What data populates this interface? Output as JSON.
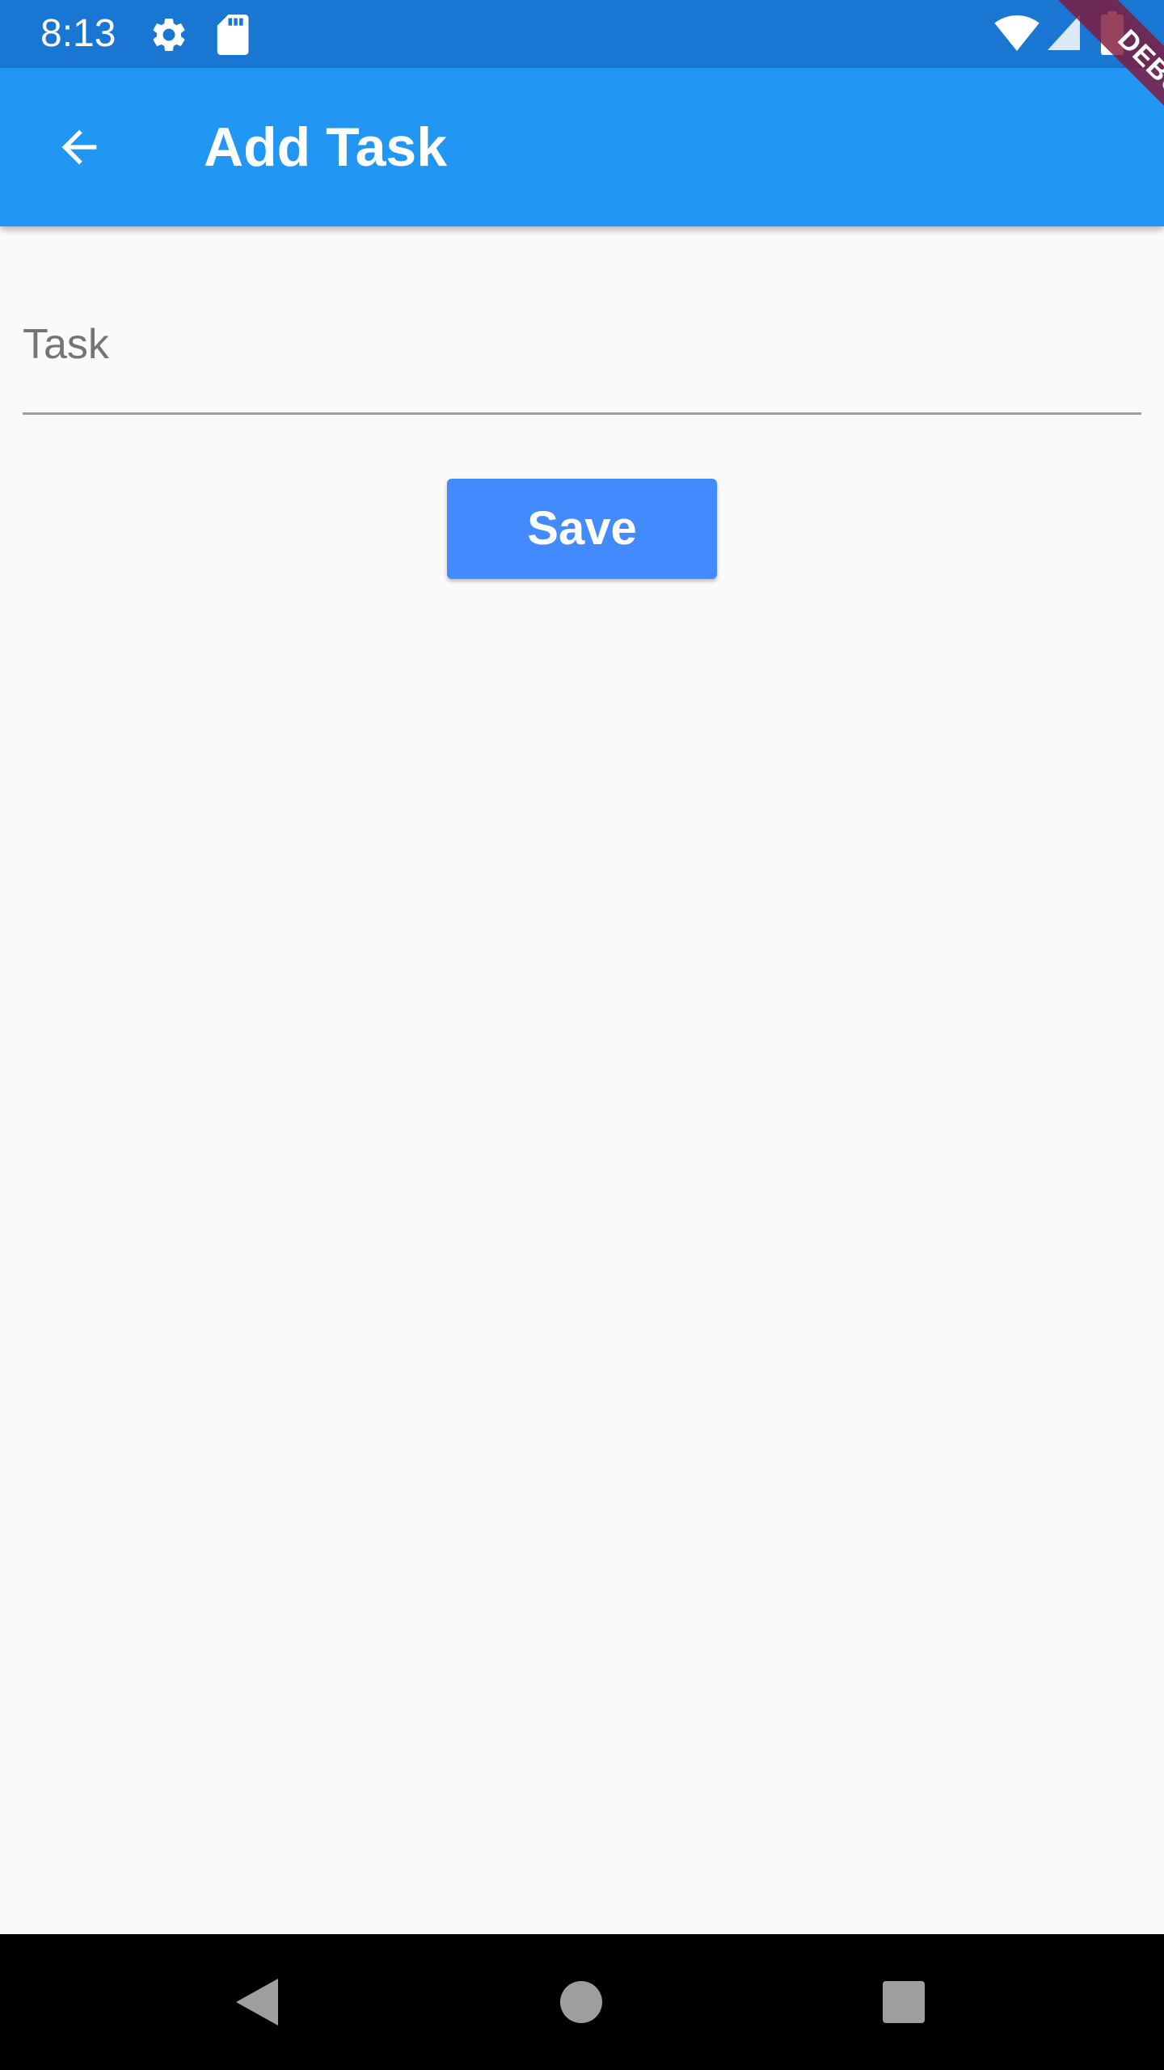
{
  "status_bar": {
    "time": "8:13",
    "icons": [
      "settings-icon",
      "sd-card-icon",
      "wifi-icon",
      "signal-icon",
      "battery-icon"
    ],
    "background": "#1976d2"
  },
  "app_bar": {
    "title": "Add Task",
    "back_icon": "arrow-back-icon",
    "background": "#2196f3"
  },
  "debug_banner": {
    "label": "DEBUG"
  },
  "form": {
    "task_placeholder": "Task",
    "task_value": "",
    "save_label": "Save",
    "save_color": "#448aff"
  },
  "nav_bar": {
    "buttons": [
      "back-triangle-icon",
      "home-circle-icon",
      "recents-square-icon"
    ]
  }
}
